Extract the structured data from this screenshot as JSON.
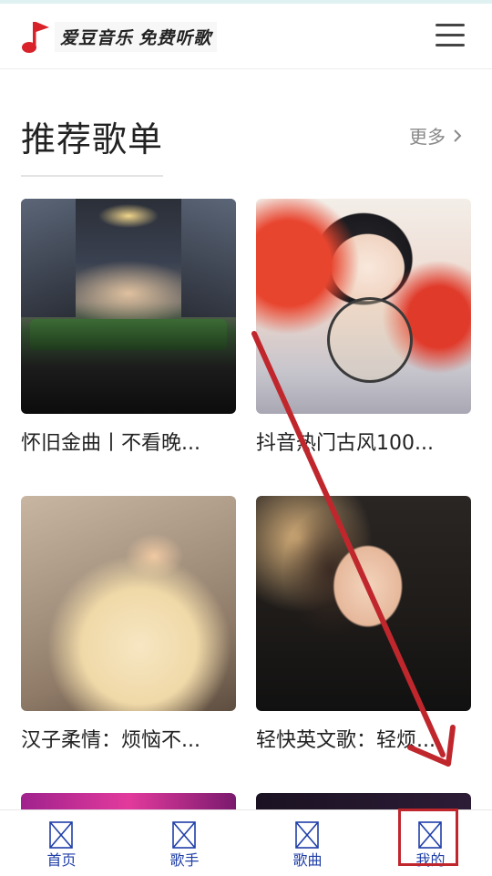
{
  "header": {
    "logo_text": "爱豆音乐 免费听歌",
    "logo_icon": "music-note-flag-icon",
    "menu_icon": "hamburger-menu-icon"
  },
  "section": {
    "title": "推荐歌单",
    "more_label": "更多",
    "more_icon": "chevron-right-icon"
  },
  "playlists": [
    {
      "title": "怀旧金曲丨不看晚..."
    },
    {
      "title": "抖音热门古风100..."
    },
    {
      "title": "汉子柔情：烦恼不..."
    },
    {
      "title": "轻快英文歌：轻烦..."
    }
  ],
  "bottom_nav": [
    {
      "label": "首页",
      "icon": "broken-image-icon"
    },
    {
      "label": "歌手",
      "icon": "broken-image-icon"
    },
    {
      "label": "歌曲",
      "icon": "broken-image-icon"
    },
    {
      "label": "我的",
      "icon": "broken-image-icon"
    }
  ],
  "annotation": {
    "color": "#c0272d",
    "target": "我的"
  },
  "colors": {
    "nav_text": "#1f3fa8",
    "accent_red": "#d8232a"
  }
}
